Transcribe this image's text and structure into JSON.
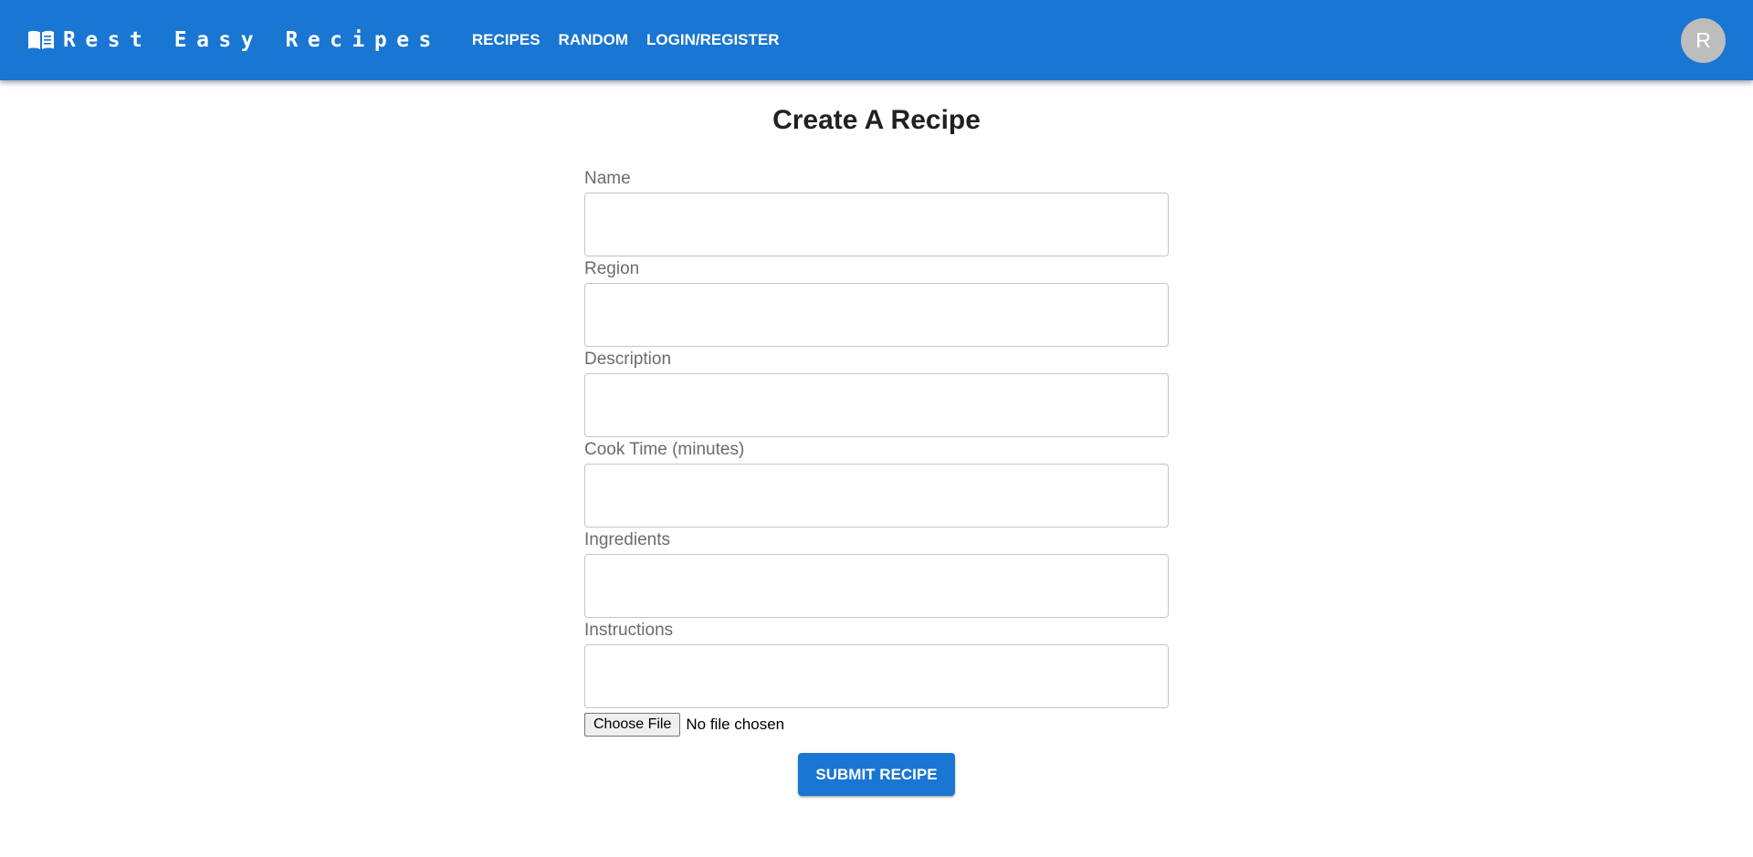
{
  "header": {
    "brand": "Rest Easy Recipes",
    "brand_icon": "open-book-icon",
    "nav": [
      {
        "label": "RECIPES"
      },
      {
        "label": "RANDOM"
      },
      {
        "label": "LOGIN/REGISTER"
      }
    ],
    "avatar_initial": "R"
  },
  "page": {
    "title": "Create A Recipe"
  },
  "form": {
    "fields": [
      {
        "label": "Name",
        "value": ""
      },
      {
        "label": "Region",
        "value": ""
      },
      {
        "label": "Description",
        "value": ""
      },
      {
        "label": "Cook Time (minutes)",
        "value": ""
      },
      {
        "label": "Ingredients",
        "value": ""
      },
      {
        "label": "Instructions",
        "value": ""
      }
    ],
    "file_button_label": "Choose File",
    "file_status": "No file chosen",
    "submit_label": "SUBMIT RECIPE"
  },
  "colors": {
    "primary": "#1976d2",
    "avatar_bg": "#bdbdbd",
    "label_text": "#6b6b6b",
    "title_text": "#212121"
  }
}
